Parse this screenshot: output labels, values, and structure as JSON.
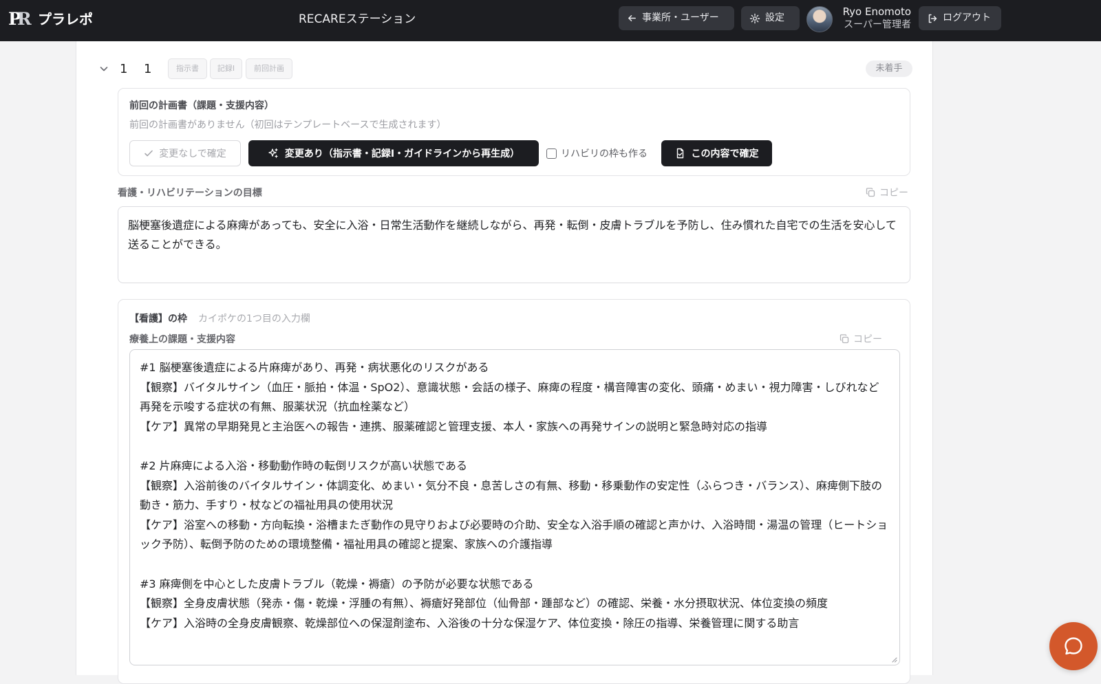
{
  "header": {
    "logo_mark": "PR",
    "app_name": "プラレポ",
    "station": "RECAREステーション",
    "office_users_label": "事業所・ユーザー",
    "settings_label": "設定",
    "user_name": "Ryo Enomoto",
    "user_role": "スーパー管理者",
    "logout_label": "ログアウト"
  },
  "row": {
    "num_a": "1",
    "num_b": "1",
    "tags": [
      "指示書",
      "記録I",
      "前回計画"
    ],
    "status": "未着手"
  },
  "prev_plan": {
    "title": "前回の計画書（課題・支援内容）",
    "note": "前回の計画書がありません（初回はテンプレートベースで生成されます）",
    "no_change_label": "変更なしで確定",
    "regen_label": "変更あり（指示書・記録I・ガイドラインから再生成）",
    "rehab_checkbox_label": "リハビリの枠も作る",
    "rehab_checked": false,
    "confirm_label": "この内容で確定"
  },
  "goal": {
    "label": "看護・リハビリテーションの目標",
    "copy_label": "コピー",
    "text": "脳梗塞後遺症による麻痺があっても、安全に入浴・日常生活動作を継続しながら、再発・転倒・皮膚トラブルを予防し、住み慣れた自宅での生活を安心して送ることができる。"
  },
  "nursing": {
    "title": "【看護】の枠",
    "subtitle": "カイポケの1つ目の入力欄",
    "issue_label": "療養上の課題・支援内容",
    "copy_label": "コピー",
    "issue_text": "#1 脳梗塞後遺症による片麻痺があり、再発・病状悪化のリスクがある\n【観察】バイタルサイン（血圧・脈拍・体温・SpO2）、意識状態・会話の様子、麻痺の程度・構音障害の変化、頭痛・めまい・視力障害・しびれなど再発を示唆する症状の有無、服薬状況（抗血栓薬など）\n【ケア】異常の早期発見と主治医への報告・連携、服薬確認と管理支援、本人・家族への再発サインの説明と緊急時対応の指導\n\n#2 片麻痺による入浴・移動動作時の転倒リスクが高い状態である\n【観察】入浴前後のバイタルサイン・体調変化、めまい・気分不良・息苦しさの有無、移動・移乗動作の安定性（ふらつき・バランス）、麻痺側下肢の動き・筋力、手すり・杖などの福祉用具の使用状況\n【ケア】浴室への移動・方向転換・浴槽またぎ動作の見守りおよび必要時の介助、安全な入浴手順の確認と声かけ、入浴時間・湯温の管理（ヒートショック予防）、転倒予防のための環境整備・福祉用具の確認と提案、家族への介護指導\n\n#3 麻痺側を中心とした皮膚トラブル（乾燥・褥瘡）の予防が必要な状態である\n【観察】全身皮膚状態（発赤・傷・乾燥・浮腫の有無）、褥瘡好発部位（仙骨部・踵部など）の確認、栄養・水分摂取状況、体位変換の頻度\n【ケア】入浴時の全身皮膚観察、乾燥部位への保湿剤塗布、入浴後の十分な保湿ケア、体位変換・除圧の指導、栄養管理に関する助言"
  },
  "colors": {
    "topbar": "#1c1d21",
    "primary_button": "#1c1d21",
    "chat_fab": "#d3582b"
  },
  "icons": {
    "office": "arrow-left-icon",
    "settings": "gear-icon",
    "logout": "logout-icon",
    "collapse": "chevron-down-icon",
    "no_change": "check-icon",
    "regen": "sparkle-icon",
    "confirm": "document-check-icon",
    "copy": "copy-icon",
    "chat": "chat-bubble-icon"
  }
}
